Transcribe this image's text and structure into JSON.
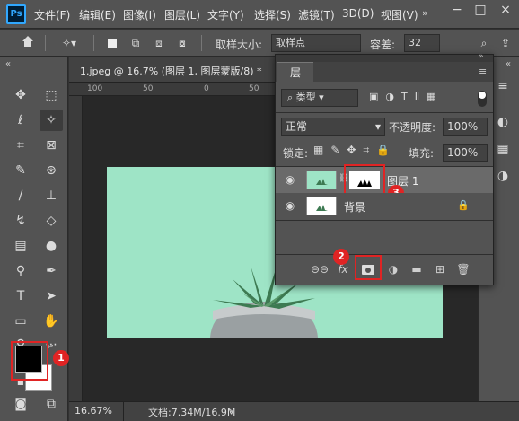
{
  "app": {
    "logo": "Ps"
  },
  "menu": [
    "文件(F)",
    "编辑(E)",
    "图像(I)",
    "图层(L)",
    "文字(Y)",
    "选择(S)",
    "滤镜(T)",
    "3D(D)",
    "视图(V)"
  ],
  "options_bar": {
    "sample_size_label": "取样大小:",
    "sample_size_value": "取样点",
    "tolerance_label": "容差:",
    "tolerance_value": "32"
  },
  "document": {
    "tab_title": "1.jpeg @ 16.7% (图层 1, 图层蒙版/8) *",
    "close": "×",
    "ruler_marks": [
      "100",
      "50",
      "0",
      "50",
      "100"
    ]
  },
  "status": {
    "zoom": "16.67%",
    "doc_info": "文档:7.34M/16.9M"
  },
  "layers_panel": {
    "title": "层",
    "filter_label": "类型",
    "blend_mode": "正常",
    "opacity_label": "不透明度:",
    "opacity_value": "100%",
    "lock_label": "锁定:",
    "fill_label": "填充:",
    "fill_value": "100%",
    "layers": [
      {
        "name": "图层 1",
        "visible": true,
        "selected": true,
        "has_mask": true
      },
      {
        "name": "背景",
        "visible": true,
        "locked": true
      }
    ]
  },
  "annotations": [
    {
      "number": "1",
      "target": "foreground-color"
    },
    {
      "number": "2",
      "target": "add-mask-button"
    },
    {
      "number": "3",
      "target": "layer-mask-thumbnail"
    }
  ],
  "colors": {
    "canvas_bg": "#9ee4c6",
    "highlight": "#e02424",
    "foreground": "#000000",
    "background": "#ffffff"
  }
}
